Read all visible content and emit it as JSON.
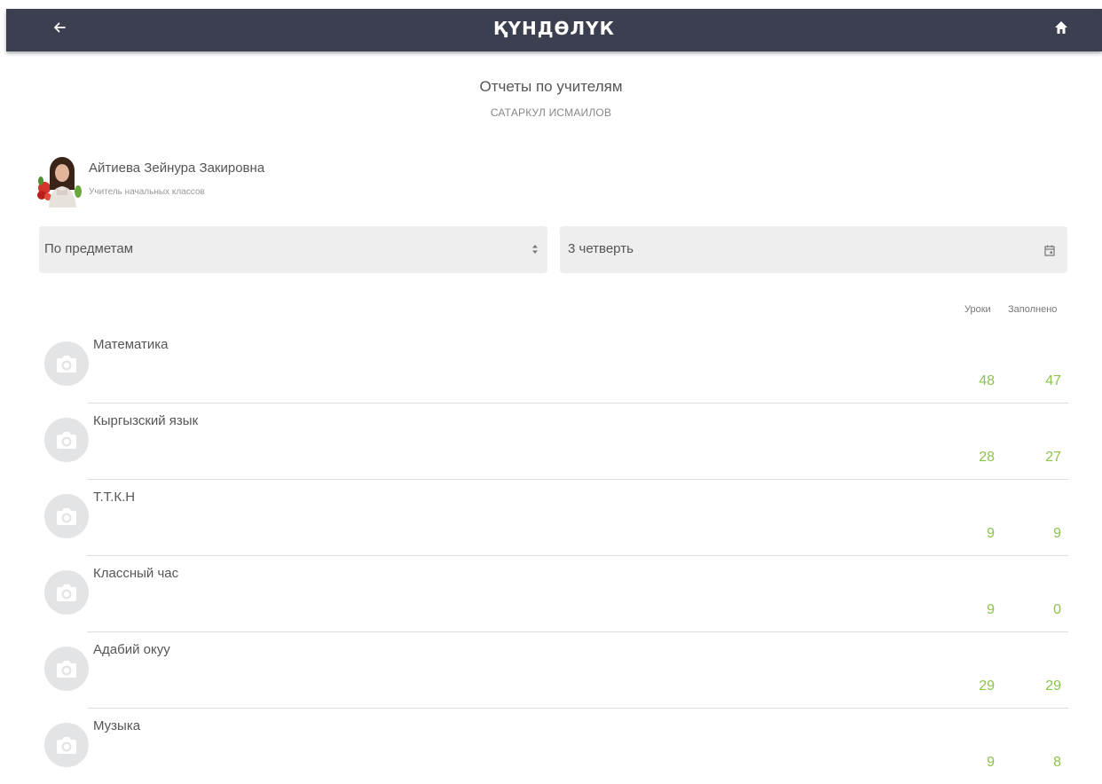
{
  "header": {
    "logo_text": "ҚҮНДӨЛҮК",
    "back_icon": "arrow-left-icon",
    "home_icon": "home-icon"
  },
  "page": {
    "title": "Отчеты по учителям",
    "subtitle": "САТАРКУЛ ИСМАИЛОВ"
  },
  "teacher": {
    "name": "Айтиева Зейнура Закировна",
    "role": "Учитель начальных классов"
  },
  "filters": {
    "group_by": "По предметам",
    "period": "3 четверть"
  },
  "table": {
    "col_lessons": "Уроки",
    "col_filled": "Заполнено",
    "rows": [
      {
        "subject": "Математика",
        "lessons": "48",
        "filled": "47"
      },
      {
        "subject": "Кыргызский язык",
        "lessons": "28",
        "filled": "27"
      },
      {
        "subject": "Т.Т.К.Н",
        "lessons": "9",
        "filled": "9"
      },
      {
        "subject": "Классный час",
        "lessons": "9",
        "filled": "0"
      },
      {
        "subject": "Адабий окуу",
        "lessons": "29",
        "filled": "29"
      },
      {
        "subject": "Музыка",
        "lessons": "9",
        "filled": "8"
      }
    ]
  },
  "colors": {
    "topbar": "#3c3f4f",
    "accent_green": "#8bc34a",
    "select_bg": "#eeeeee"
  }
}
